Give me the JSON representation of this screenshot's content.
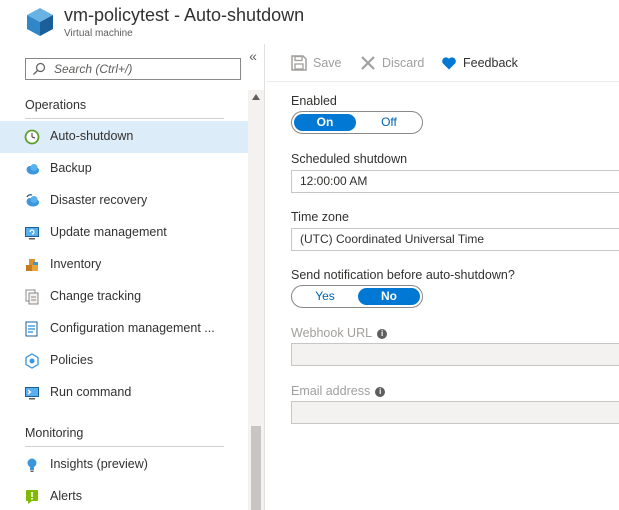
{
  "header": {
    "title": "vm-policytest - Auto-shutdown",
    "subtitle": "Virtual machine"
  },
  "sidebar": {
    "collapse_label": "«",
    "search": {
      "placeholder": "Search (Ctrl+/)"
    },
    "sections": [
      {
        "title": "Operations",
        "items": [
          {
            "label": "Auto-shutdown",
            "icon": "clock-icon",
            "active": true
          },
          {
            "label": "Backup",
            "icon": "backup-cloud-icon"
          },
          {
            "label": "Disaster recovery",
            "icon": "disaster-recovery-icon"
          },
          {
            "label": "Update management",
            "icon": "update-management-icon"
          },
          {
            "label": "Inventory",
            "icon": "inventory-icon"
          },
          {
            "label": "Change tracking",
            "icon": "change-tracking-icon"
          },
          {
            "label": "Configuration management ...",
            "icon": "configuration-management-icon"
          },
          {
            "label": "Policies",
            "icon": "policies-icon"
          },
          {
            "label": "Run command",
            "icon": "run-command-icon"
          }
        ]
      },
      {
        "title": "Monitoring",
        "items": [
          {
            "label": "Insights (preview)",
            "icon": "insights-bulb-icon"
          },
          {
            "label": "Alerts",
            "icon": "alerts-icon"
          }
        ]
      }
    ]
  },
  "toolbar": {
    "save_label": "Save",
    "discard_label": "Discard",
    "feedback_label": "Feedback"
  },
  "form": {
    "enabled": {
      "label": "Enabled",
      "on": "On",
      "off": "Off",
      "value": "On"
    },
    "scheduled_shutdown": {
      "label": "Scheduled shutdown",
      "value": "12:00:00 AM"
    },
    "time_zone": {
      "label": "Time zone",
      "value": "(UTC) Coordinated Universal Time"
    },
    "notification": {
      "label": "Send notification before auto-shutdown?",
      "yes": "Yes",
      "no": "No",
      "value": "No"
    },
    "webhook": {
      "label": "Webhook URL",
      "value": ""
    },
    "email": {
      "label": "Email address",
      "value": ""
    }
  },
  "colors": {
    "accent": "#0078d4",
    "active_nav_bg": "#ddecf9",
    "feedback_heart": "#0078d4"
  }
}
